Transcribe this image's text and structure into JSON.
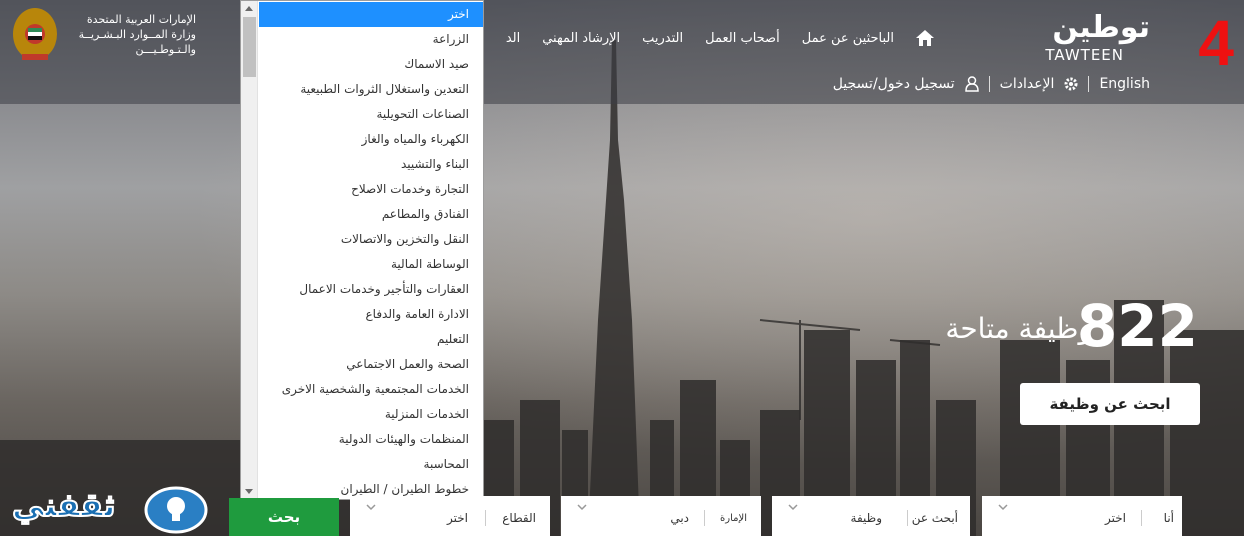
{
  "header": {
    "ministry_lines": [
      "الإمارات العربية المتحدة",
      "وزارة المــوارد البـشـريــة",
      "والـتـوطـيـــن"
    ],
    "logo_ar": "توطين",
    "logo_en": "TAWTEEN",
    "badge": "4",
    "nav": [
      "الباحثين عن عمل",
      "أصحاب العمل",
      "التدريب",
      "الإرشاد المهني",
      "الد"
    ],
    "login": "تسجيل دخول/تسجيل",
    "settings": "الإعدادات",
    "language": "English"
  },
  "hero": {
    "count": "822",
    "text": "وظيفة متاحة",
    "button": "ابحث عن وظيفة"
  },
  "dropdown": {
    "options": [
      "اختر",
      "الزراعة",
      "صيد الاسماك",
      "التعدين واستغلال الثروات الطبيعية",
      "الصناعات التحويلية",
      "الكهرباء والمياه والغاز",
      "البناء والتشييد",
      "التجارة وخدمات الاصلاح",
      "الفنادق والمطاعم",
      "النقل والتخزين والاتصالات",
      "الوساطة المالية",
      "العقارات والتأجير وخدمات الاعمال",
      "الادارة العامة والدفاع",
      "التعليم",
      "الصحة والعمل الاجتماعي",
      "الخدمات المجتمعية والشخصية الاخرى",
      "الخدمات المنزلية",
      "المنظمات والهيئات الدولية",
      "المحاسبة",
      "خطوط الطيران / الطيران"
    ],
    "selected_index": 0
  },
  "search": {
    "i_am_label": "أنا",
    "i_am_value": "اختر",
    "search_for_label": "أبحث عن",
    "search_for_value": "وظيفة",
    "emirate_label": "الإمارة",
    "emirate_value": "دبي",
    "sector_label": "القطاع",
    "sector_value": "اختر",
    "button": "بحث"
  },
  "watermark": {
    "text": "ثقفني"
  },
  "colors": {
    "accent_green": "#1f9b3e",
    "badge_red": "#ee1111",
    "selected_blue": "#1e90ff",
    "watermark_blue": "#1a6fb3"
  }
}
